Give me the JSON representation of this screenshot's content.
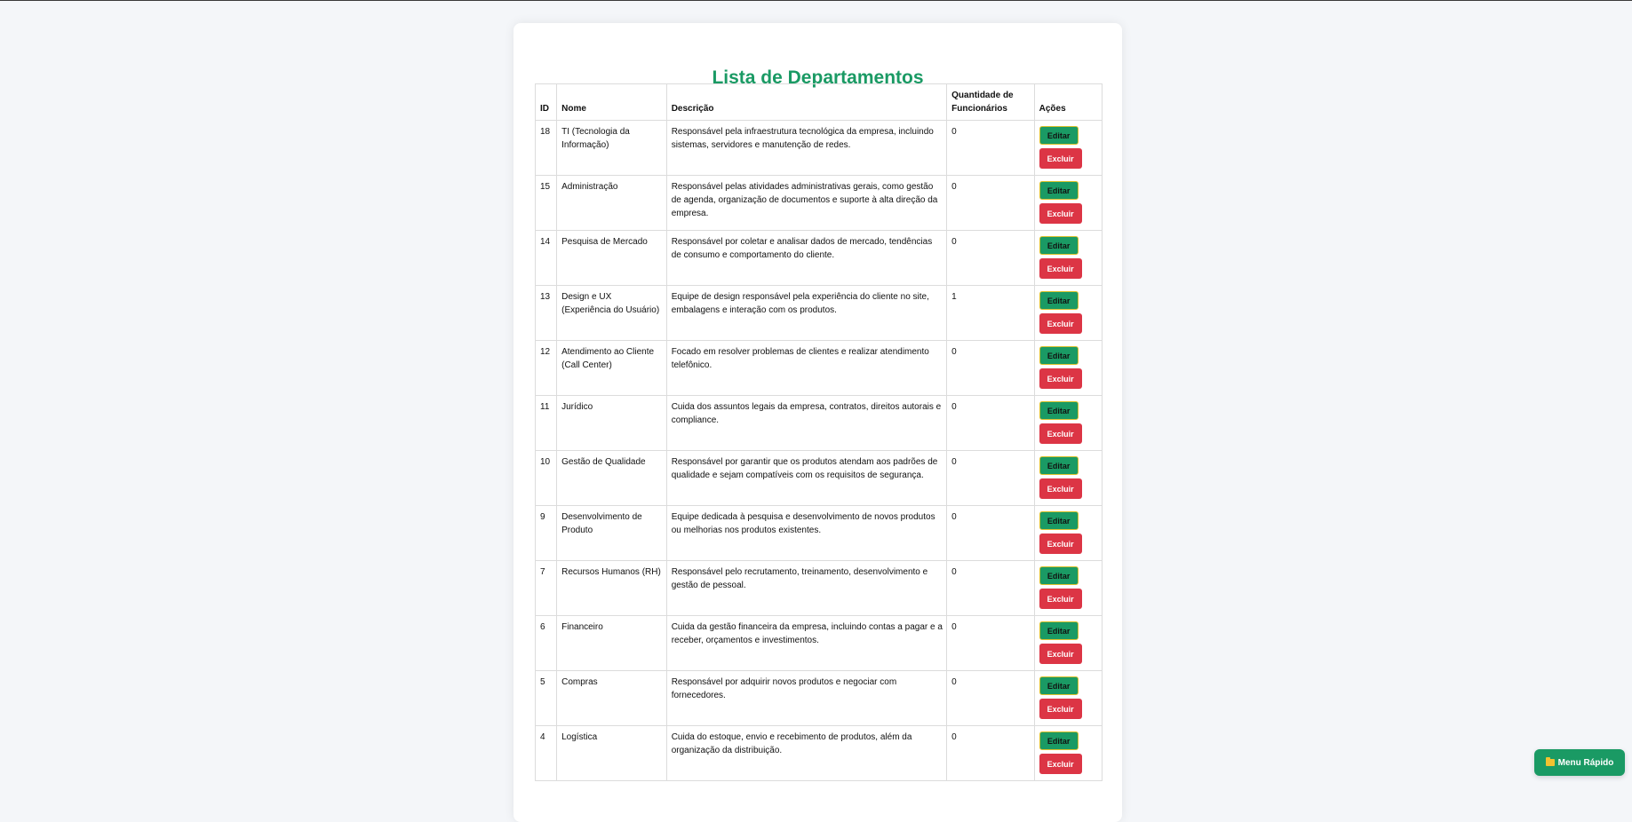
{
  "page": {
    "title": "Lista de Departamentos"
  },
  "table": {
    "headers": {
      "id": "ID",
      "nome": "Nome",
      "descricao": "Descrição",
      "quantidade": "Quantidade de Funcionários",
      "acoes": "Ações"
    },
    "rows": [
      {
        "id": "18",
        "nome": "TI (Tecnologia da Informação)",
        "descricao": "Responsável pela infraestrutura tecnológica da empresa, incluindo sistemas, servidores e manutenção de redes.",
        "quantidade": "0"
      },
      {
        "id": "15",
        "nome": "Administração",
        "descricao": "Responsável pelas atividades administrativas gerais, como gestão de agenda, organização de documentos e suporte à alta direção da empresa.",
        "quantidade": "0"
      },
      {
        "id": "14",
        "nome": "Pesquisa de Mercado",
        "descricao": "Responsável por coletar e analisar dados de mercado, tendências de consumo e comportamento do cliente.",
        "quantidade": "0"
      },
      {
        "id": "13",
        "nome": "Design e UX (Experiência do Usuário)",
        "descricao": "Equipe de design responsável pela experiência do cliente no site, embalagens e interação com os produtos.",
        "quantidade": "1"
      },
      {
        "id": "12",
        "nome": "Atendimento ao Cliente (Call Center)",
        "descricao": "Focado em resolver problemas de clientes e realizar atendimento telefônico.",
        "quantidade": "0"
      },
      {
        "id": "11",
        "nome": "Jurídico",
        "descricao": "Cuida dos assuntos legais da empresa, contratos, direitos autorais e compliance.",
        "quantidade": "0"
      },
      {
        "id": "10",
        "nome": "Gestão de Qualidade",
        "descricao": "Responsável por garantir que os produtos atendam aos padrões de qualidade e sejam compatíveis com os requisitos de segurança.",
        "quantidade": "0"
      },
      {
        "id": "9",
        "nome": "Desenvolvimento de Produto",
        "descricao": "Equipe dedicada à pesquisa e desenvolvimento de novos produtos ou melhorias nos produtos existentes.",
        "quantidade": "0"
      },
      {
        "id": "7",
        "nome": "Recursos Humanos (RH)",
        "descricao": "Responsável pelo recrutamento, treinamento, desenvolvimento e gestão de pessoal.",
        "quantidade": "0"
      },
      {
        "id": "6",
        "nome": "Financeiro",
        "descricao": "Cuida da gestão financeira da empresa, incluindo contas a pagar e a receber, orçamentos e investimentos.",
        "quantidade": "0"
      },
      {
        "id": "5",
        "nome": "Compras",
        "descricao": "Responsável por adquirir novos produtos e negociar com fornecedores.",
        "quantidade": "0"
      },
      {
        "id": "4",
        "nome": "Logística",
        "descricao": "Cuida do estoque, envio e recebimento de produtos, além da organização da distribuição.",
        "quantidade": "0"
      }
    ],
    "edit_label": "Editar",
    "delete_label": "Excluir"
  },
  "quick_menu": {
    "icon": "folder-icon",
    "label": "Menu Rápido"
  },
  "colors": {
    "accent": "#1a9a64",
    "danger": "#dc3545",
    "background": "#f4f6f9"
  }
}
